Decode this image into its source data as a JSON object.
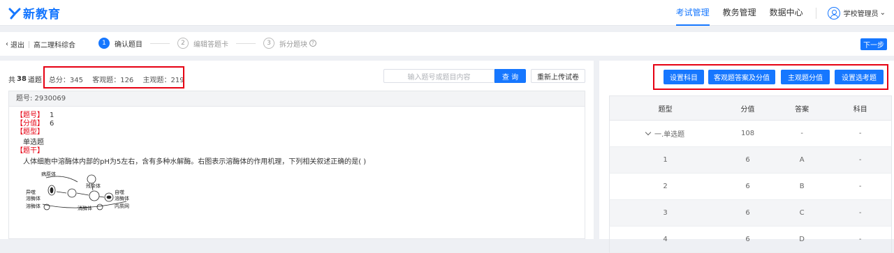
{
  "app": {
    "logo_text": "新教育"
  },
  "topnav": {
    "items": [
      {
        "label": "考试管理",
        "active": true
      },
      {
        "label": "教务管理",
        "active": false
      },
      {
        "label": "数据中心",
        "active": false
      }
    ],
    "user_label": "学校管理员"
  },
  "stepbar": {
    "back_label": "退出",
    "exam_name": "高二理科综合",
    "steps": [
      {
        "num": "1",
        "label": "确认题目"
      },
      {
        "num": "2",
        "label": "编辑答题卡"
      },
      {
        "num": "3",
        "label": "拆分题块"
      }
    ],
    "next_label": "下一步"
  },
  "summary": {
    "count_prefix": "共",
    "count": "38",
    "count_suffix": "道题",
    "total": "总分：345",
    "objective": "客观题：126",
    "subjective": "主观题：219"
  },
  "search": {
    "placeholder": "输入题号或题目内容",
    "button_label": "查 询"
  },
  "reupload_label": "重新上传试卷",
  "question": {
    "id_label": "题号: 2930069",
    "number_tag": "【题号】",
    "number_value": "1",
    "score_tag": "【分值】",
    "score_value": "6",
    "type_tag": "【题型】",
    "type_value": "单选题",
    "stem_tag": "【题干】",
    "stem_text": "人体细胞中溶酶体内部的pH为5左右，含有多种水解酶。右图表示溶酶体的作用机理，下列相关叙述正确的是(     )",
    "figure_labels": {
      "pathogen": "病原体",
      "residual": "残余体",
      "heterophagic": "异噬",
      "heterophagic2": "溶酶体",
      "lysosome": "溶酶体",
      "autophagic": "自噬",
      "autophagic2": "溶酶体",
      "digestive": "消酶体",
      "er": "内质网"
    }
  },
  "right": {
    "buttons": [
      "设置科目",
      "客观题答案及分值",
      "主观题分值",
      "设置选考题"
    ],
    "table": {
      "headers": [
        "题型",
        "分值",
        "答案",
        "科目"
      ],
      "rows": [
        {
          "type": "一.单选题",
          "score": "108",
          "answer": "-",
          "subject": "-"
        },
        {
          "type": "1",
          "score": "6",
          "answer": "A",
          "subject": "-"
        },
        {
          "type": "2",
          "score": "6",
          "answer": "B",
          "subject": "-"
        },
        {
          "type": "3",
          "score": "6",
          "answer": "C",
          "subject": "-"
        },
        {
          "type": "4",
          "score": "6",
          "answer": "D",
          "subject": "-"
        }
      ]
    }
  },
  "colors": {
    "accent": "#1677ff",
    "highlight": "#e60012"
  }
}
